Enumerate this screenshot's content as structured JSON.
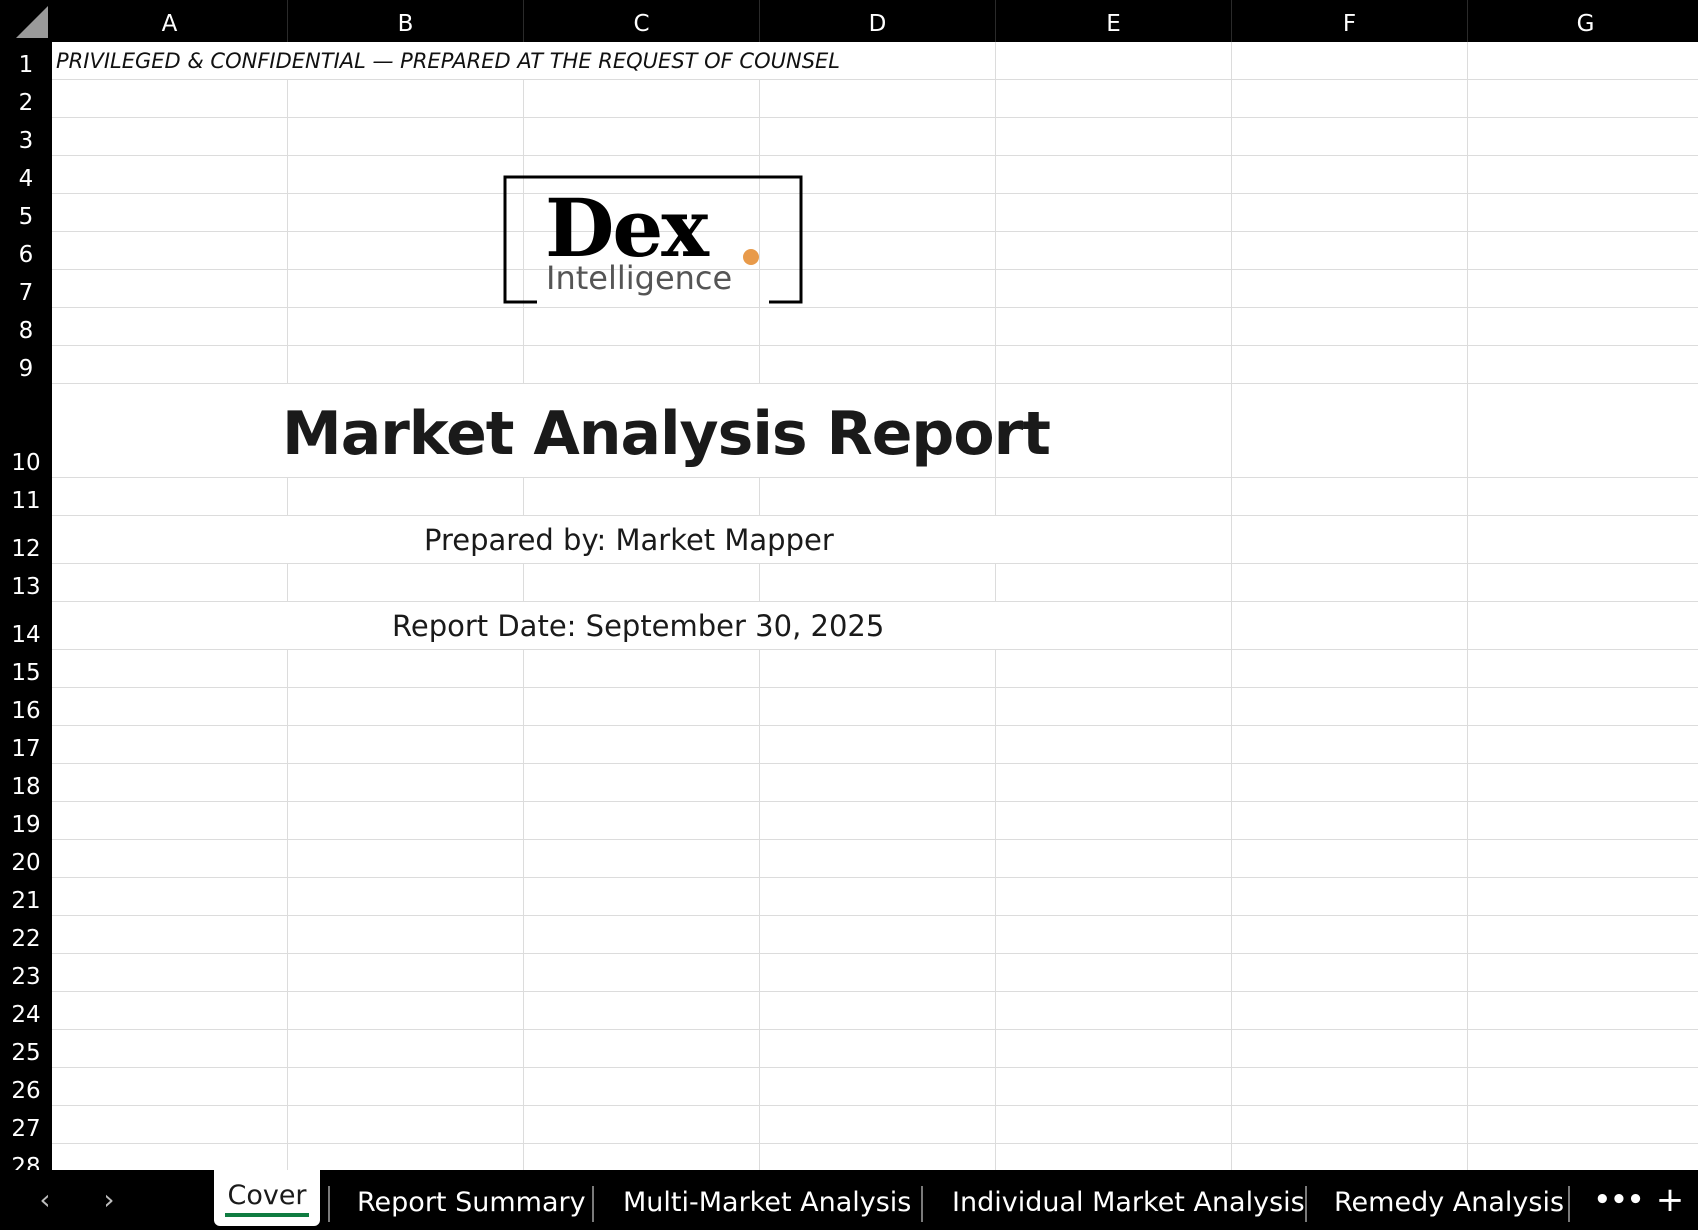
{
  "columns": [
    "A",
    "B",
    "C",
    "D",
    "E",
    "F",
    "G"
  ],
  "rows": [
    "1",
    "2",
    "3",
    "4",
    "5",
    "6",
    "7",
    "8",
    "9",
    "10",
    "11",
    "12",
    "13",
    "14",
    "15",
    "16",
    "17",
    "18",
    "19",
    "20",
    "21",
    "22",
    "23",
    "24",
    "25",
    "26",
    "27",
    "28"
  ],
  "cells": {
    "confidential_banner": "PRIVILEGED & CONFIDENTIAL — PREPARED AT THE REQUEST OF COUNSEL",
    "title": "Market Analysis Report",
    "prepared_by": "Prepared by: Market Mapper",
    "report_date": "Report Date: September 30, 2025"
  },
  "logo": {
    "brand": "Dex",
    "subtitle": "Intelligence",
    "dot_color": "#e89a4a"
  },
  "tabs": {
    "active": "Cover",
    "items": [
      "Report Summary",
      "Multi-Market Analysis",
      "Individual Market Analysis",
      "Remedy Analysis"
    ],
    "prev_icon": "‹",
    "next_icon": "›",
    "more_icon": "•••",
    "add_icon": "+"
  },
  "colors": {
    "header_bg": "#000000",
    "gridline": "#dcdcdc",
    "active_tab_underline": "#107c41"
  }
}
